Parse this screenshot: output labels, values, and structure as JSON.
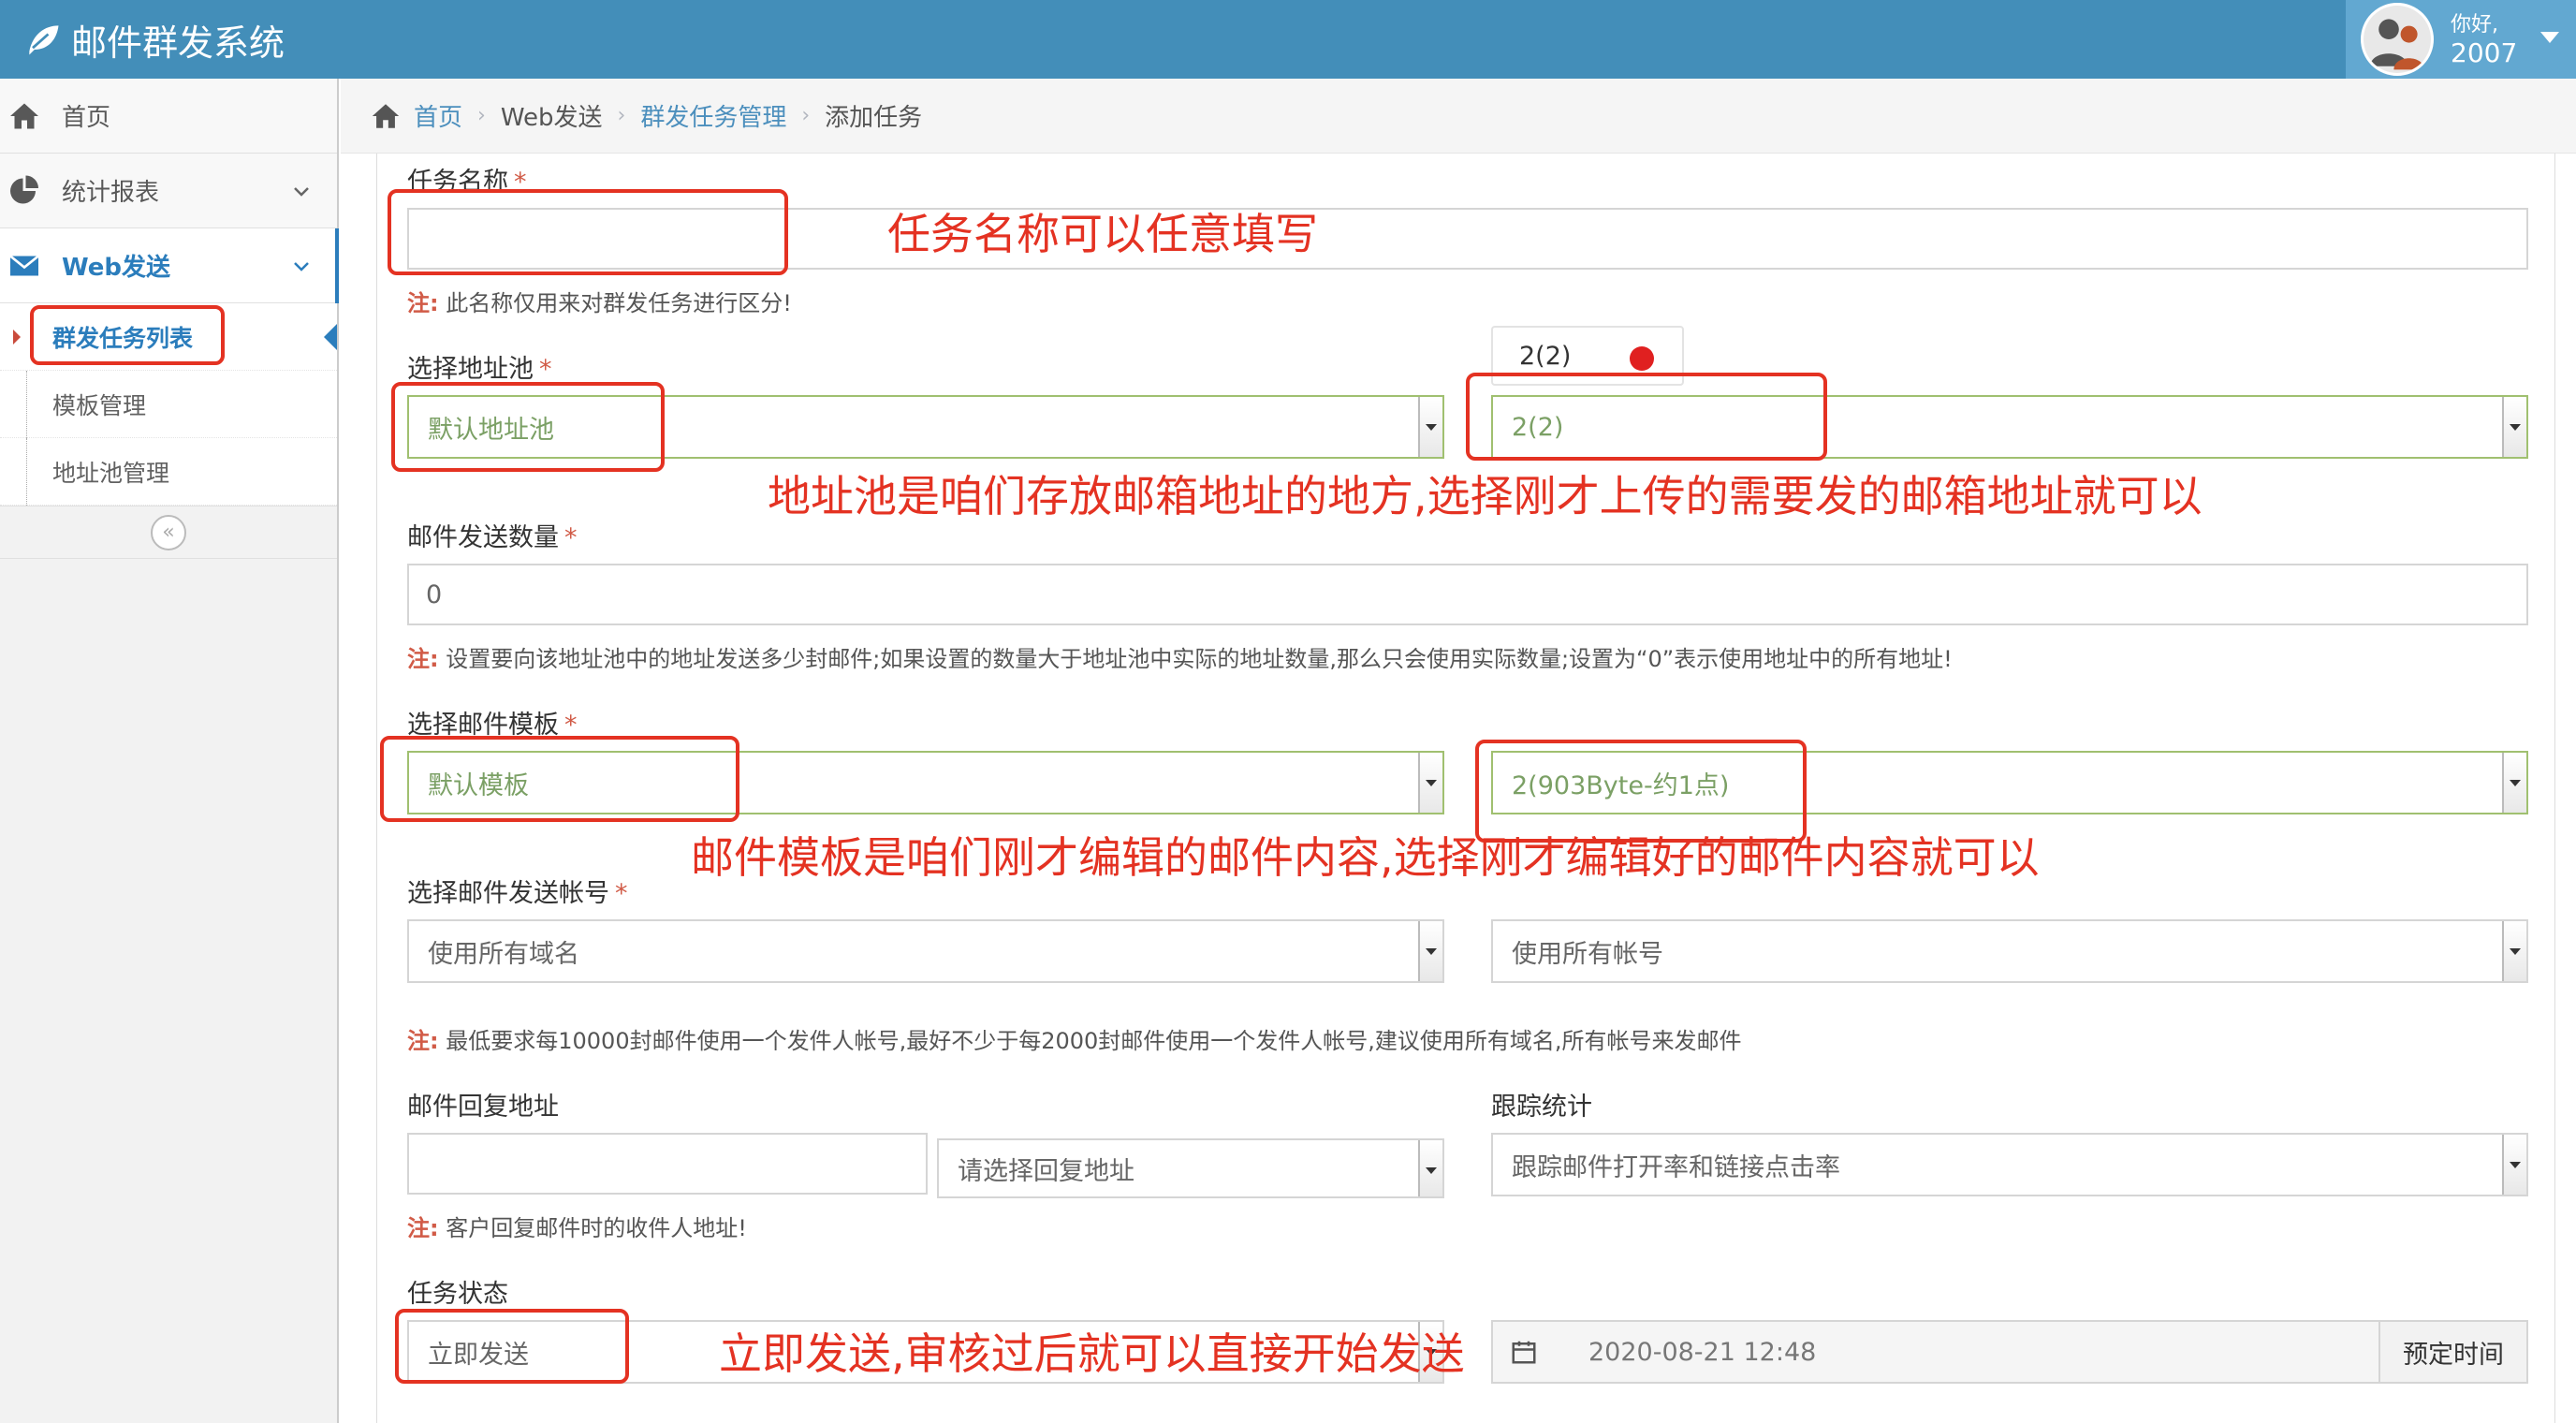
{
  "header": {
    "title": "邮件群发系统",
    "greeting": "你好,",
    "username": "2007"
  },
  "sidebar": {
    "items": [
      {
        "label": "首页"
      },
      {
        "label": "统计报表"
      },
      {
        "label": "Web发送"
      }
    ],
    "subitems": [
      {
        "label": "群发任务列表"
      },
      {
        "label": "模板管理"
      },
      {
        "label": "地址池管理"
      }
    ],
    "collapse_symbol": "«"
  },
  "breadcrumb": {
    "home": "首页",
    "level2": "Web发送",
    "level3": "群发任务管理",
    "current": "添加任务",
    "sep": "›"
  },
  "form": {
    "required_mark": "*",
    "note_prefix": "注:",
    "task_name": {
      "label": "任务名称",
      "value": "",
      "note": "此名称仅用来对群发任务进行区分!"
    },
    "pool": {
      "label": "选择地址池",
      "selected": "默认地址池",
      "tag": "2(2)",
      "sub_selected": "2(2)"
    },
    "send_count": {
      "label": "邮件发送数量",
      "value": "0",
      "note": "设置要向该地址池中的地址发送多少封邮件;如果设置的数量大于地址池中实际的地址数量,那么只会使用实际数量;设置为“0”表示使用地址中的所有地址!"
    },
    "template": {
      "label": "选择邮件模板",
      "selected": "默认模板",
      "sub_selected": "2(903Byte-约1点)"
    },
    "account": {
      "label": "选择邮件发送帐号",
      "domain": "使用所有域名",
      "account": "使用所有帐号",
      "note": "最低要求每10000封邮件使用一个发件人帐号,最好不少于每2000封邮件使用一个发件人帐号,建议使用所有域名,所有帐号来发邮件"
    },
    "reply": {
      "label": "邮件回复地址",
      "value": "",
      "select": "请选择回复地址",
      "note": "客户回复邮件时的收件人地址!"
    },
    "tracking": {
      "label": "跟踪统计",
      "selected": "跟踪邮件打开率和链接点击率"
    },
    "status": {
      "label": "任务状态",
      "selected": "立即发送",
      "datetime": "2020-08-21 12:48",
      "schedule_button": "预定时间"
    }
  },
  "annotations": {
    "task_name": "任务名称可以任意填写",
    "pool": "地址池是咱们存放邮箱地址的地方,选择刚才上传的需要发的邮箱地址就可以",
    "template": "邮件模板是咱们刚才编辑的邮件内容,选择刚才编辑好的邮件内容就可以",
    "status": "立即发送,审核过后就可以直接开始发送"
  },
  "colors": {
    "header": "#438eb9",
    "userbox": "#62a8d1",
    "accent": "#2b7dbc",
    "annotation": "#e43222",
    "valid": "#7ba065"
  }
}
